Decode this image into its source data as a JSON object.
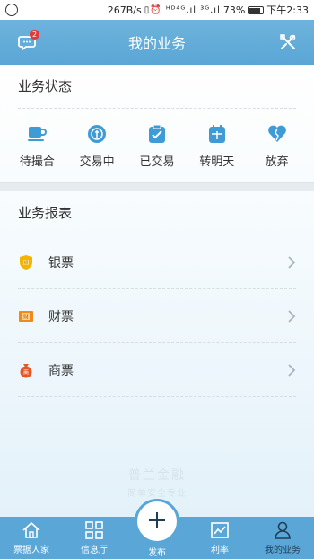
{
  "status_bar": {
    "speed": "267B/s",
    "battery": "73%",
    "time": "下午2:33"
  },
  "header": {
    "title": "我的业务",
    "message_badge": "2",
    "left_icon": "message-icon",
    "right_icon": "tools-icon"
  },
  "business_status": {
    "title": "业务状态",
    "items": [
      {
        "label": "待撮合",
        "icon": "cup-icon"
      },
      {
        "label": "交易中",
        "icon": "exchange-icon"
      },
      {
        "label": "已交易",
        "icon": "clipboard-check-icon"
      },
      {
        "label": "转明天",
        "icon": "calendar-icon"
      },
      {
        "label": "放弃",
        "icon": "broken-heart-icon"
      }
    ]
  },
  "business_report": {
    "title": "业务报表",
    "items": [
      {
        "label": "银票",
        "icon": "bank-ticket-icon"
      },
      {
        "label": "财票",
        "icon": "finance-ticket-icon"
      },
      {
        "label": "商票",
        "icon": "money-bag-icon"
      }
    ]
  },
  "watermark": {
    "brand": "普兰金融",
    "slogan": "简单安全专业"
  },
  "tabbar": {
    "tabs": [
      {
        "label": "票据人家"
      },
      {
        "label": "信息厅"
      },
      {
        "label": "发布"
      },
      {
        "label": "利率"
      },
      {
        "label": "我的业务"
      }
    ]
  },
  "colors": {
    "primary": "#5aa6d6",
    "icon_blue": "#3f9bd6",
    "badge_red": "#e53935"
  }
}
